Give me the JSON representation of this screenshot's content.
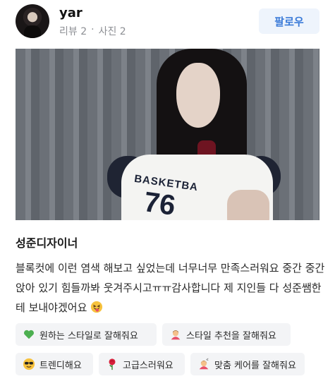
{
  "user": {
    "name": "yar",
    "reviews": "리뷰 2",
    "separator": "·",
    "photos": "사진 2",
    "follow_label": "팔로우"
  },
  "review": {
    "designer": "성준디자이너",
    "body": "블록컷에 이런 염색 해보고 싶었는데 너무너무 만족스러워요 중간 중간 앉아 있기 힘들까봐 웃겨주시고ㅠㅠ감사합니다 제 지인들 다 성준쌤한테 보내야겠어요",
    "photo_print_line1": "BASKETBA",
    "photo_print_line2": "76"
  },
  "tags": [
    {
      "label": "원하는 스타일로 잘해줘요",
      "icon": "green-heart-icon"
    },
    {
      "label": "스타일 추천을 잘해줘요",
      "icon": "person-tipping-hand-icon"
    },
    {
      "label": "트렌디해요",
      "icon": "sunglasses-face-icon"
    },
    {
      "label": "고급스러워요",
      "icon": "rose-icon"
    },
    {
      "label": "맞춤 케어를 잘해줘요",
      "icon": "person-getting-haircut-icon"
    }
  ],
  "colors": {
    "accent_blue": "#3b7bd8",
    "follow_bg": "#eef4fc",
    "tag_bg": "#f3f4f6",
    "meta_gray": "#8d8f94"
  }
}
